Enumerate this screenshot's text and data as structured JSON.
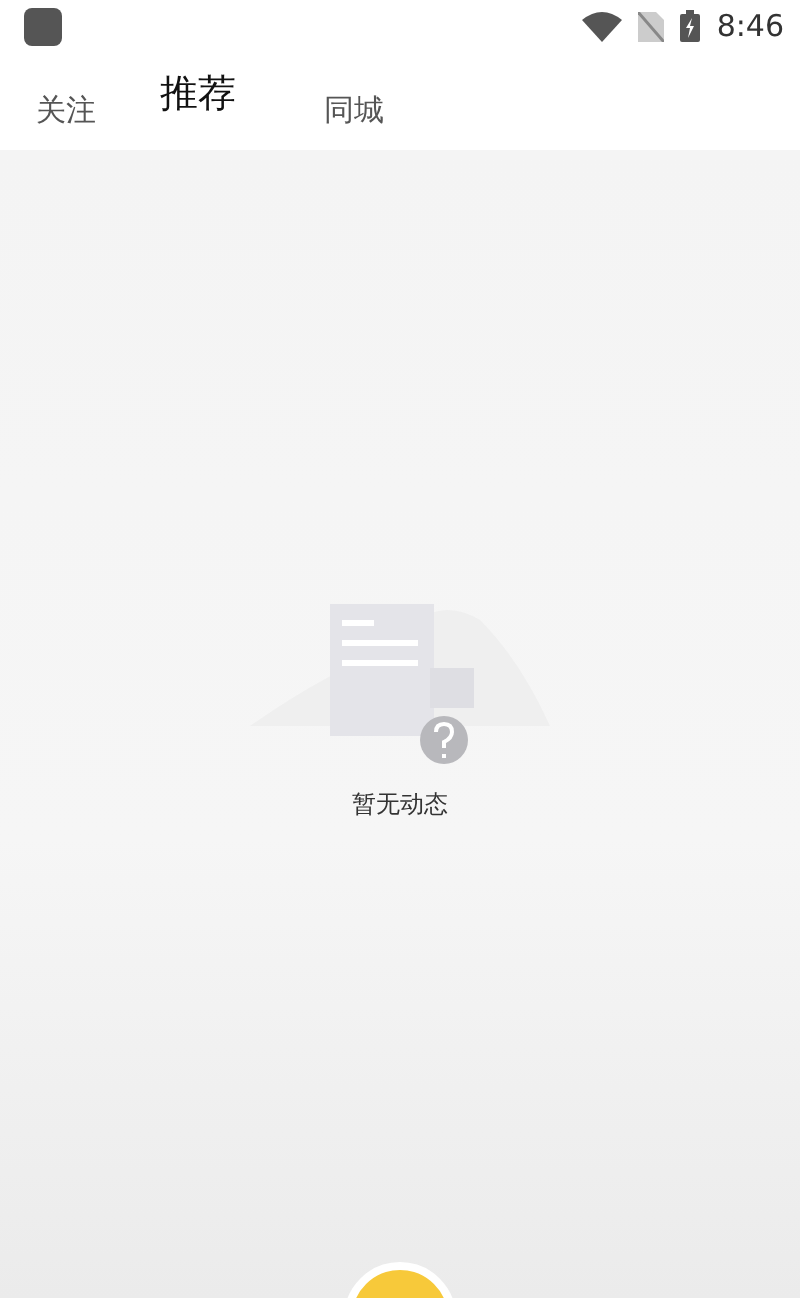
{
  "status_bar": {
    "time": "8:46"
  },
  "tabs": [
    {
      "label": "关注",
      "selected": false
    },
    {
      "label": "推荐",
      "selected": true
    },
    {
      "label": "同城",
      "selected": false
    }
  ],
  "empty_state": {
    "message": "暂无动态"
  }
}
